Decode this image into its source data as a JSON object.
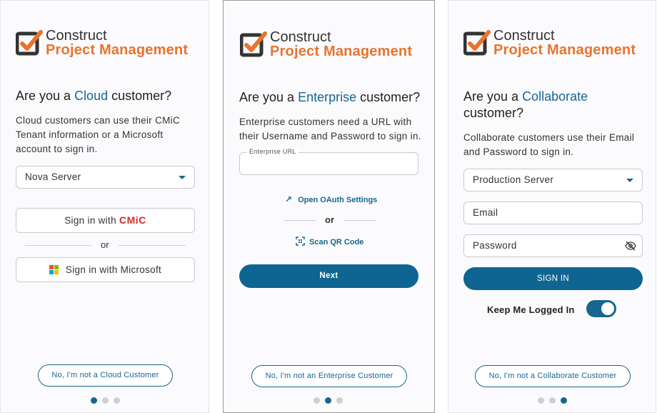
{
  "brand": {
    "line1": "Construct",
    "line2": "Project Management"
  },
  "cloud": {
    "heading_prefix": "Are you a",
    "heading_accent": "Cloud",
    "heading_suffix": "customer?",
    "description": "Cloud customers can use their CMiC Tenant information or a Microsoft account to sign in.",
    "server_select": "Nova Server",
    "signin_cmic_prefix": "Sign in with",
    "signin_cmic_brand": "CMiC",
    "or": "or",
    "signin_microsoft": "Sign in with Microsoft",
    "not_customer": "No, I'm not a Cloud Customer"
  },
  "enterprise": {
    "heading_prefix": "Are you a",
    "heading_accent": "Enterprise",
    "heading_suffix": "customer?",
    "description": "Enterprise customers need a URL with their Username and Password to sign in.",
    "url_label": "Enterprise URL",
    "url_value": "",
    "oauth_link": "Open OAuth Settings",
    "or": "or",
    "scan_qr": "Scan QR Code",
    "next": "Next",
    "not_customer": "No, I'm not an Enterprise Customer"
  },
  "collaborate": {
    "heading_prefix": "Are you a",
    "heading_accent": "Collaborate",
    "heading_suffix": "customer?",
    "description": "Collaborate customers use their Email and Password to sign in.",
    "server_select": "Production Server",
    "email_placeholder": "Email",
    "password_placeholder": "Password",
    "signin": "SIGN IN",
    "keep_logged_in": "Keep Me Logged In",
    "keep_logged_in_on": true,
    "not_customer": "No, I'm not a Collaborate Customer"
  },
  "colors": {
    "accent": "#17668f",
    "brand_orange": "#e8742f",
    "cmic_red": "#d62a2a"
  },
  "pagination": {
    "total": 3,
    "active_cloud": 1,
    "active_enterprise": 2,
    "active_collaborate": 3
  }
}
